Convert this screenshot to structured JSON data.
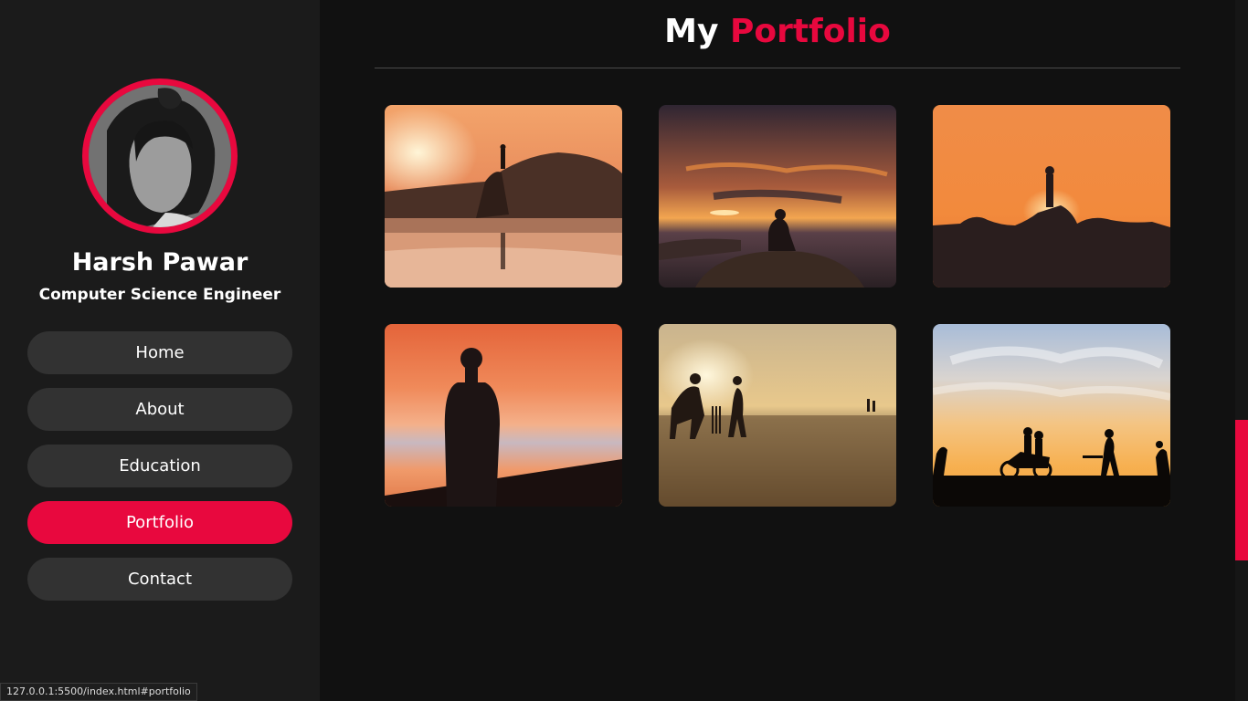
{
  "profile": {
    "name": "Harsh Pawar",
    "title": "Computer Science Engineer",
    "avatar_icon": "profile-photo"
  },
  "nav": {
    "home": "Home",
    "about": "About",
    "education": "Education",
    "portfolio": "Portfolio",
    "contact": "Contact",
    "active": "Portfolio"
  },
  "section": {
    "title_prefix": "My",
    "title_accent": "Portfolio"
  },
  "gallery": [
    {
      "subject": "person standing on rocks at sunset over water"
    },
    {
      "subject": "person sitting on rock photographing sunset"
    },
    {
      "subject": "silhouette standing on rocks in front of sun"
    },
    {
      "subject": "silhouette of man against orange sky"
    },
    {
      "subject": "cricket players silhouetted at sunset"
    },
    {
      "subject": "motorbike and cricket players silhouetted at sunset"
    }
  ],
  "status_bar": {
    "url": "127.0.0.1:5500/index.html#portfolio"
  },
  "colors": {
    "accent": "#e8083e",
    "sidebar_bg": "#1b1b1b",
    "main_bg": "#111111",
    "button_bg": "#323232"
  }
}
